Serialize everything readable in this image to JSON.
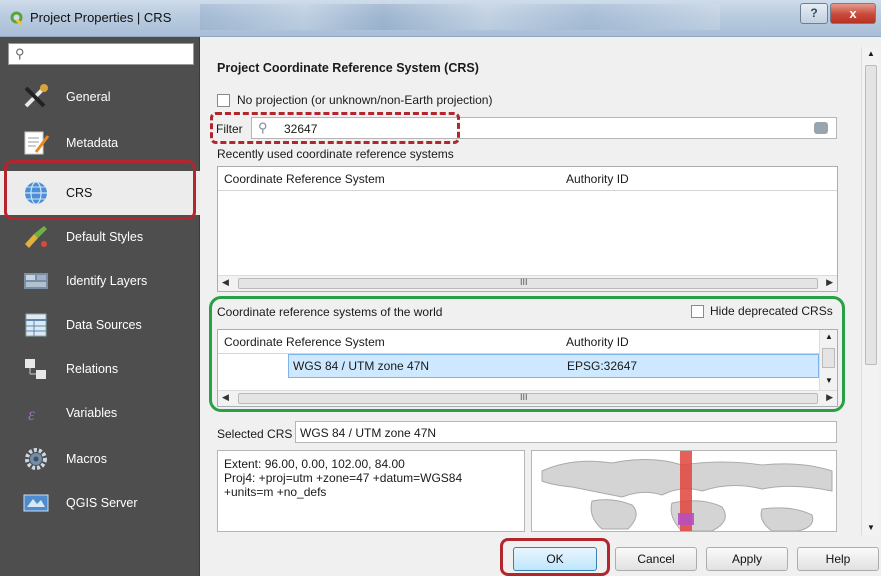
{
  "window": {
    "title": "Project Properties | CRS",
    "help_label": "?",
    "close_label": "x"
  },
  "sidebar": {
    "search_placeholder": "",
    "items": [
      {
        "label": "General",
        "icon": "wrench-icon"
      },
      {
        "label": "Metadata",
        "icon": "document-edit-icon"
      },
      {
        "label": "CRS",
        "icon": "globe-icon",
        "active": true
      },
      {
        "label": "Default Styles",
        "icon": "paint-brush-icon"
      },
      {
        "label": "Identify Layers",
        "icon": "identify-layers-icon"
      },
      {
        "label": "Data Sources",
        "icon": "data-sources-icon"
      },
      {
        "label": "Relations",
        "icon": "relations-icon"
      },
      {
        "label": "Variables",
        "icon": "variables-icon"
      },
      {
        "label": "Macros",
        "icon": "gear-icon"
      },
      {
        "label": "QGIS Server",
        "icon": "server-icon"
      }
    ]
  },
  "crs": {
    "section_title": "Project Coordinate Reference System (CRS)",
    "no_projection_label": "No projection (or unknown/non-Earth projection)",
    "filter_label": "Filter",
    "filter_value": "32647",
    "recent_label": "Recently used coordinate reference systems",
    "recent_table": {
      "col1": "Coordinate Reference System",
      "col2": "Authority ID",
      "rows": []
    },
    "world_label": "Coordinate reference systems of the world",
    "hide_deprecated_label": "Hide deprecated CRSs",
    "world_table": {
      "col1": "Coordinate Reference System",
      "col2": "Authority ID",
      "rows": [
        {
          "name": "WGS 84 / UTM zone 47N",
          "authority": "EPSG:32647"
        }
      ]
    },
    "scroll_mark": "III",
    "selected_label": "Selected CRS",
    "selected_value": "WGS 84 / UTM zone 47N",
    "details": [
      "Extent: 96.00, 0.00, 102.00, 84.00",
      "Proj4: +proj=utm +zone=47 +datum=WGS84",
      "+units=m +no_defs"
    ]
  },
  "buttons": {
    "ok": "OK",
    "cancel": "Cancel",
    "apply": "Apply",
    "help": "Help"
  },
  "colors": {
    "sidebar_bg": "#4e4e4e",
    "annotation_red": "#b3262e",
    "annotation_green": "#27a046",
    "selection": "#cde8ff",
    "map_band": "#e0443c"
  }
}
